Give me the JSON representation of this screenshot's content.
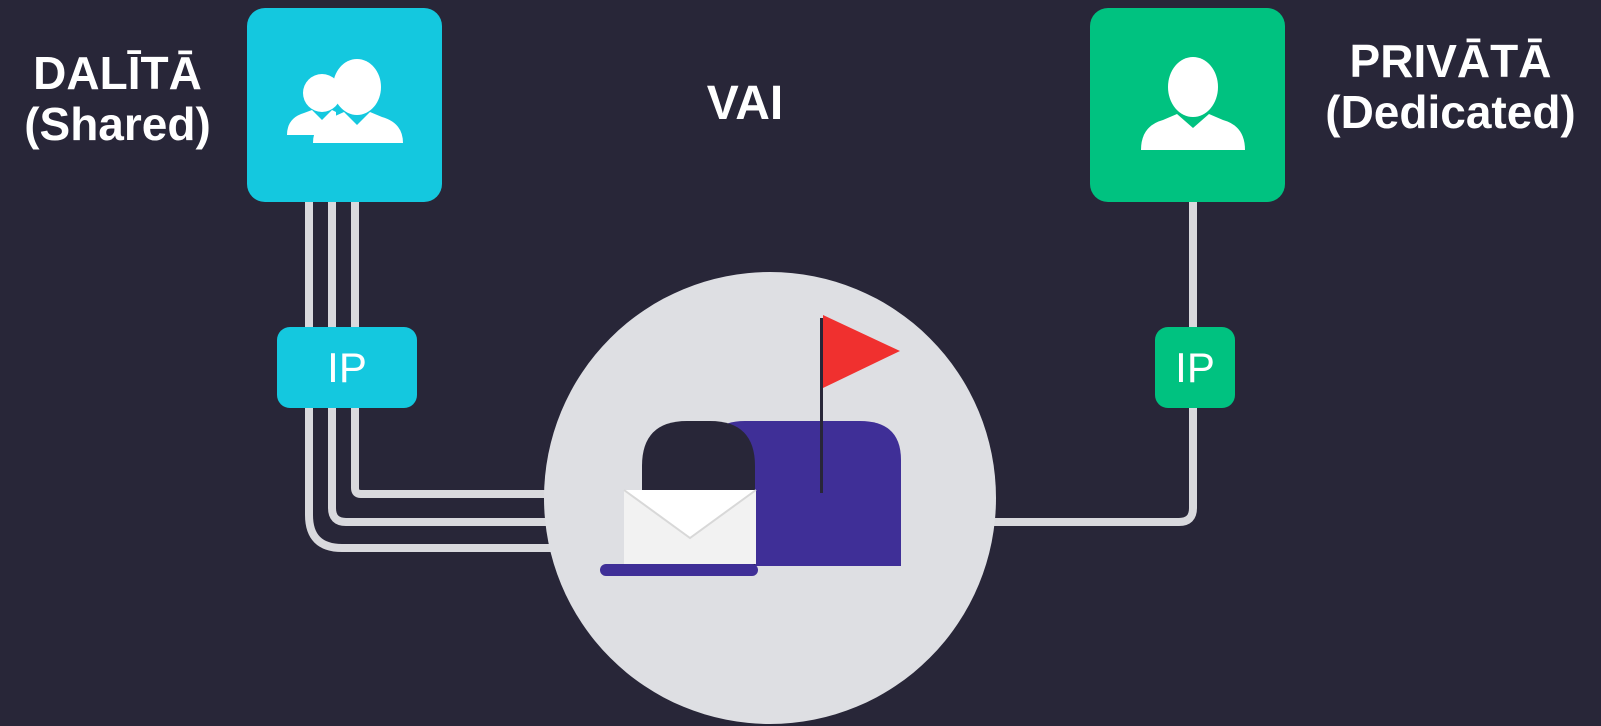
{
  "labels": {
    "shared_line1": "DALĪTĀ",
    "shared_line2": "(Shared)",
    "dedicated_line1": "PRIVĀTĀ",
    "dedicated_line2": "(Dedicated)",
    "or": "VAI"
  },
  "ip_badges": {
    "shared": "IP",
    "dedicated": "IP"
  },
  "icons": {
    "shared": "users-group-icon",
    "dedicated": "single-user-icon",
    "center": "mailbox-with-envelope-icon",
    "flag": "flag-icon"
  },
  "colors": {
    "background": "#282638",
    "shared_accent": "#14C8DF",
    "dedicated_accent": "#00C280",
    "circle": "#DEDFE3",
    "mailbox": "#3F2F97",
    "flag": "#F0302F",
    "line": "#D9D9DD",
    "envelope": "#F2F2F2"
  }
}
